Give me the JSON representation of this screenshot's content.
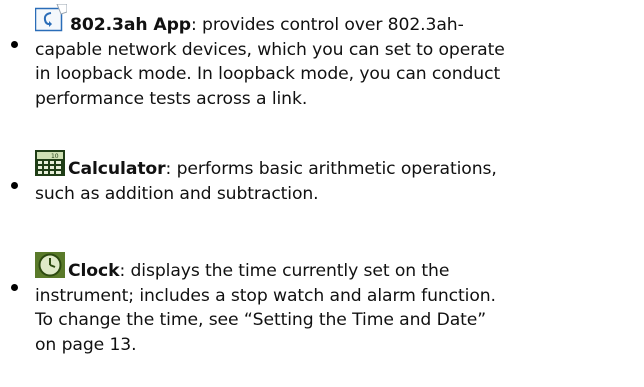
{
  "items": [
    {
      "title": "802.3ah App",
      "line1": ": provides control over 802.3ah-",
      "line2": "capable network devices, which you can set to operate",
      "line3": "in loopback mode. In loopback mode, you can conduct",
      "line4": "performance tests across a link.",
      "icon": "loopback-app-icon"
    },
    {
      "title": "Calculator",
      "line1": ": performs basic arithmetic operations,",
      "line2": "such as addition and subtraction.",
      "icon": "calculator-icon"
    },
    {
      "title": "Clock",
      "line1": ": displays the time currently set on the",
      "line2": "instrument; includes a stop watch and alarm function.",
      "line3": "To change the time, see “Setting the Time and Date”",
      "line4": "on page 13.",
      "icon": "clock-icon"
    }
  ]
}
